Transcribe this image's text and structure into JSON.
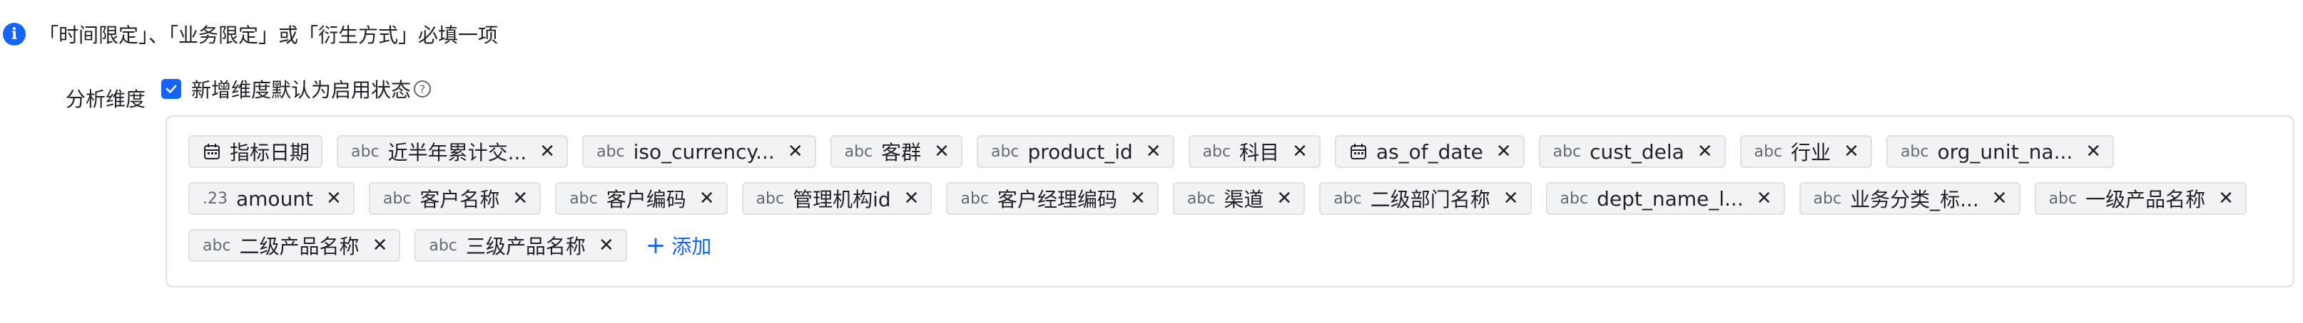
{
  "hint": {
    "text": "「时间限定」、「业务限定」或「衍生方式」必填一项",
    "icon": "info-icon"
  },
  "dimension": {
    "label": "分析维度",
    "checkbox_label": "新增维度默认为启用状态",
    "checked": true,
    "tags": [
      {
        "type": "calendar",
        "label": "指标日期",
        "closable": false
      },
      {
        "type": "abc",
        "label": "近半年累计交...",
        "closable": true
      },
      {
        "type": "abc",
        "label": "iso_currency...",
        "closable": true
      },
      {
        "type": "abc",
        "label": "客群",
        "closable": true
      },
      {
        "type": "abc",
        "label": "product_id",
        "closable": true
      },
      {
        "type": "abc",
        "label": "科目",
        "closable": true
      },
      {
        "type": "calendar",
        "label": "as_of_date",
        "closable": true
      },
      {
        "type": "abc",
        "label": "cust_dela",
        "closable": true
      },
      {
        "type": "abc",
        "label": "行业",
        "closable": true
      },
      {
        "type": "abc",
        "label": "org_unit_na...",
        "closable": true
      },
      {
        "type": ".23",
        "label": "amount",
        "closable": true
      },
      {
        "type": "abc",
        "label": "客户名称",
        "closable": true
      },
      {
        "type": "abc",
        "label": "客户编码",
        "closable": true
      },
      {
        "type": "abc",
        "label": "管理机构id",
        "closable": true
      },
      {
        "type": "abc",
        "label": "客户经理编码",
        "closable": true
      },
      {
        "type": "abc",
        "label": "渠道",
        "closable": true
      },
      {
        "type": "abc",
        "label": "二级部门名称",
        "closable": true
      },
      {
        "type": "abc",
        "label": "dept_name_l...",
        "closable": true
      },
      {
        "type": "abc",
        "label": "业务分类_标...",
        "closable": true
      },
      {
        "type": "abc",
        "label": "一级产品名称",
        "closable": true
      },
      {
        "type": "abc",
        "label": "二级产品名称",
        "closable": true
      },
      {
        "type": "abc",
        "label": "三级产品名称",
        "closable": true
      }
    ],
    "add_label": "添加"
  },
  "colors": {
    "accent": "#1664ff",
    "tag_bg": "#f2f3f5",
    "border": "#dee0e3",
    "text": "#1f2329"
  }
}
